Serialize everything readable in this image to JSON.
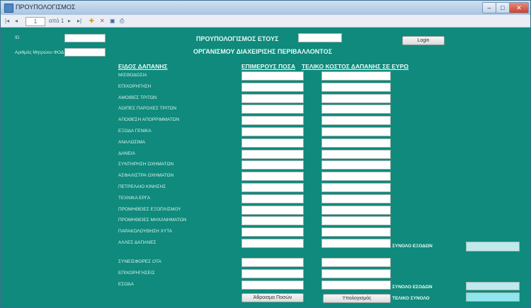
{
  "window": {
    "title": "ΠΡΟΥΠΟΛΟΓΙΣΜΟΣ"
  },
  "toolbar": {
    "page": "1",
    "page_of": "από 1"
  },
  "fields": {
    "id_label": "ID",
    "reg_label": "Αριθμός Μητρώου ΦΟΔΣΑ"
  },
  "header": {
    "title_prefix": "ΠΡΟΥΠΟΛΟΓΙΣΜΟΣ ΕΤΟΥΣ",
    "subtitle": "ΟΡΓΑΝΙΣΜΟΥ ΔΙΑΧΕΙΡΙΣΗΣ ΠΕΡΙΒΑΛΛΟΝΤΟΣ",
    "login_label": "Login"
  },
  "columns": {
    "type": "ΕΙΔΟΣ ΔΑΠΑΝΗΣ",
    "percent": "ΕΠΙΜΕΡΟΥΣ ΠΟΣΑ",
    "total": "ΤΕΛΙΚΟ ΚΟΣΤΟΣ ΔΑΠΑΝΗΣ ΣΕ ΕΥΡΩ"
  },
  "expense_rows": [
    {
      "label": "ΜΙΣΘΟΔΟΣΙΑ"
    },
    {
      "label": "ΕΠΙΧΟΡΗΓΗΣΗ"
    },
    {
      "label": "ΑΜΟΙΒΕΣ ΤΡΙΤΩΝ"
    },
    {
      "label": "ΛΟΙΠΕΣ ΠΑΡΟΧΕΣ ΤΡΙΤΩΝ"
    },
    {
      "label": "ΑΠΟΘΕΣΗ ΑΠΟΡΡΙΜΜΑΤΩΝ"
    },
    {
      "label": "ΕΞΟΔΑ ΓΕΝΙΚΑ"
    },
    {
      "label": "ΑΝΑΛΩΣΙΜΑ"
    },
    {
      "label": "ΔΑΝΕΙΑ"
    },
    {
      "label": "ΣΥΝΤΗΡΗΣΗ ΟΧΗΜΑΤΩΝ"
    },
    {
      "label": "ΑΣΦΑΛΙΣΤΡΑ ΟΧΗΜΑΤΩΝ"
    },
    {
      "label": "ΠΕΤΡΕΛΑΙΟ ΚΙΝΗΣΗΣ"
    },
    {
      "label": "ΤΕΧΝΙΚΑ ΕΡΓΑ"
    },
    {
      "label": "ΠΡΟΜΗΘΕΙΕΣ ΕΞΟΠΛΙΣΜΟΥ"
    },
    {
      "label": "ΠΡΟΜΗΘΕΙΕΣ ΜΗΧΑΝΗΜΑΤΩΝ"
    },
    {
      "label": "ΠΑΡΑΚΟΛΟΥΘΗΣΗ ΧΥΤΑ"
    },
    {
      "label": "ΑΛΛΕΣ ΔΑΠΑΝΕΣ"
    }
  ],
  "income_rows": [
    {
      "label": "ΣΥΝΕΙΣΦΟΡΕΣ ΟΤΑ"
    },
    {
      "label": "ΕΠΙΧΟΡΗΓΗΣΕΙΣ"
    },
    {
      "label": "ΕΣΟΔΑ"
    }
  ],
  "totals": {
    "expenses_label": "ΣΥΝΟΛΟ ΕΞΟΔΩΝ",
    "income_label": "ΣΥΝΟΛΟ ΕΣΟΔΩΝ",
    "final_label": "ΤΕΛΙΚΟ ΣΥΝΟΛΟ"
  },
  "buttons": {
    "calc_amounts": "Άθροισμα Ποσών",
    "calc": "Υπολογισμός"
  },
  "colors": {
    "background": "#0f8a7c",
    "accent_cyan": "#8ee6ec"
  },
  "icons": [
    "first-page-icon",
    "prev-page-icon",
    "next-page-icon",
    "last-page-icon",
    "add-icon",
    "delete-icon",
    "save-icon",
    "print-icon"
  ]
}
